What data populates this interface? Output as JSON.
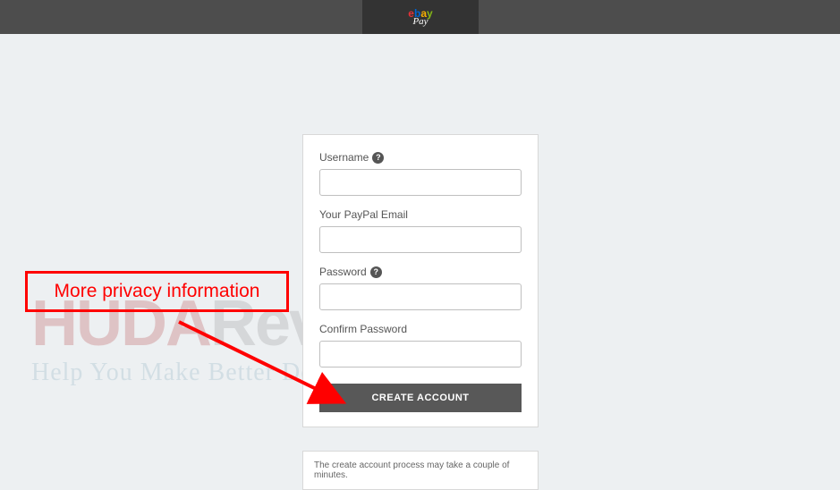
{
  "logo": {
    "e": "e",
    "b": "b",
    "a": "a",
    "y": "y",
    "pay": "Pay"
  },
  "form": {
    "username_label": "Username",
    "paypal_label": "Your PayPal Email",
    "password_label": "Password",
    "confirm_label": "Confirm Password",
    "submit_label": "CREATE ACCOUNT"
  },
  "notice": "The create account process may take a couple of minutes.",
  "annotation": "More privacy information",
  "watermark": {
    "title_huda": "HUDA",
    "title_review": "Review",
    "sub": "Help You Make Better Decisions"
  }
}
